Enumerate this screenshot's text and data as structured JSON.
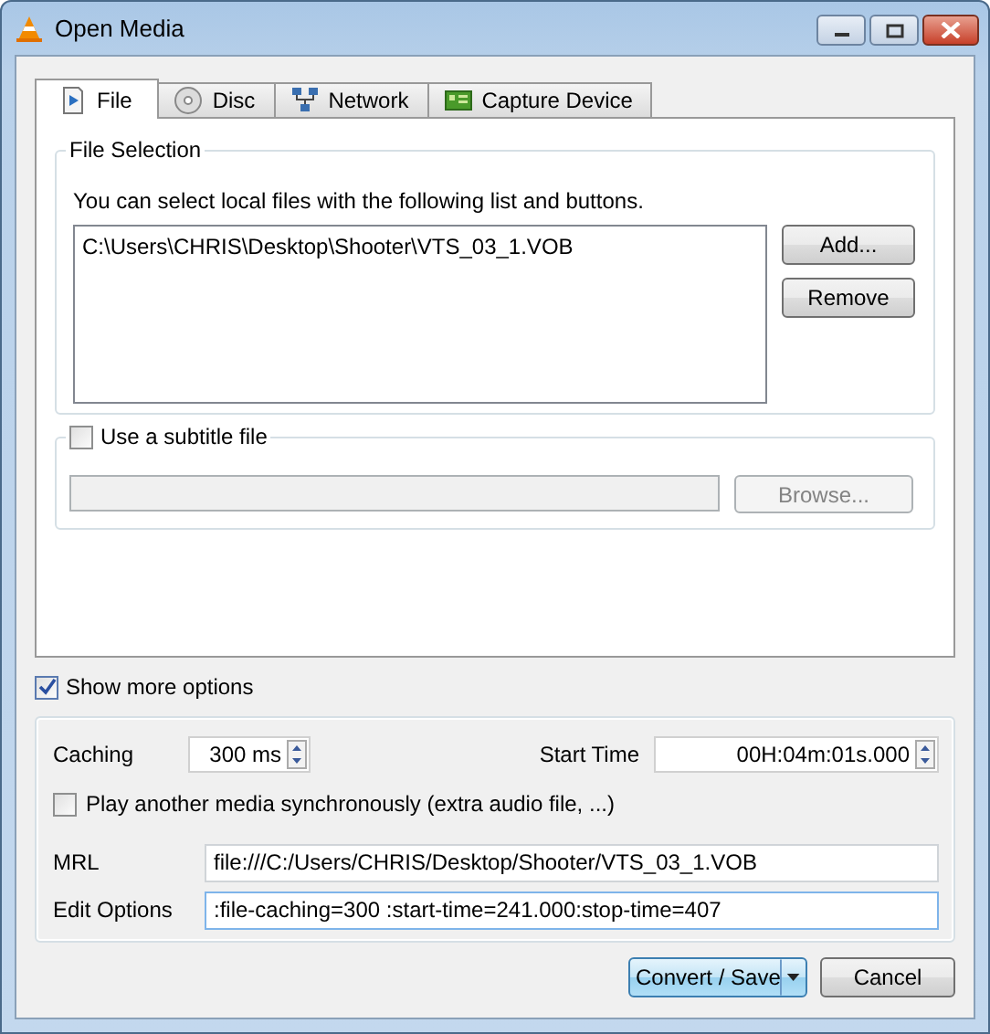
{
  "window": {
    "title": "Open Media"
  },
  "tabs": [
    {
      "label": "File",
      "kind": "file",
      "selected": true
    },
    {
      "label": "Disc",
      "kind": "disc",
      "selected": false
    },
    {
      "label": "Network",
      "kind": "network",
      "selected": false
    },
    {
      "label": "Capture Device",
      "kind": "capture",
      "selected": false
    }
  ],
  "file_selection": {
    "title": "File Selection",
    "hint": "You can select local files with the following list and buttons.",
    "files": [
      "C:\\Users\\CHRIS\\Desktop\\Shooter\\VTS_03_1.VOB"
    ],
    "buttons": [
      "Add...",
      "Remove"
    ]
  },
  "subtitle": {
    "label": "Use a subtitle file",
    "checked": false,
    "disabled": true,
    "button": "Browse..."
  },
  "show_more_options": {
    "label": "Show more options",
    "checked": true
  },
  "options": {
    "caching": {
      "label": "Caching",
      "value": "300 ms"
    },
    "start_time": {
      "label": "Start Time",
      "value": "00H:04m:01s.000"
    },
    "sync": {
      "label": "Play another media synchronously (extra audio file, ...)",
      "checked": false
    },
    "mrl": {
      "label": "MRL",
      "value": "file:///C:/Users/CHRIS/Desktop/Shooter/VTS_03_1.VOB"
    },
    "edit_options": {
      "label": "Edit Options",
      "value": ":file-caching=300 :start-time=241.000:stop-time=407"
    }
  },
  "buttons": [
    {
      "label": "Convert / Save",
      "kind": "split",
      "default": true
    },
    {
      "label": "Cancel",
      "kind": "plain",
      "default": false
    }
  ]
}
